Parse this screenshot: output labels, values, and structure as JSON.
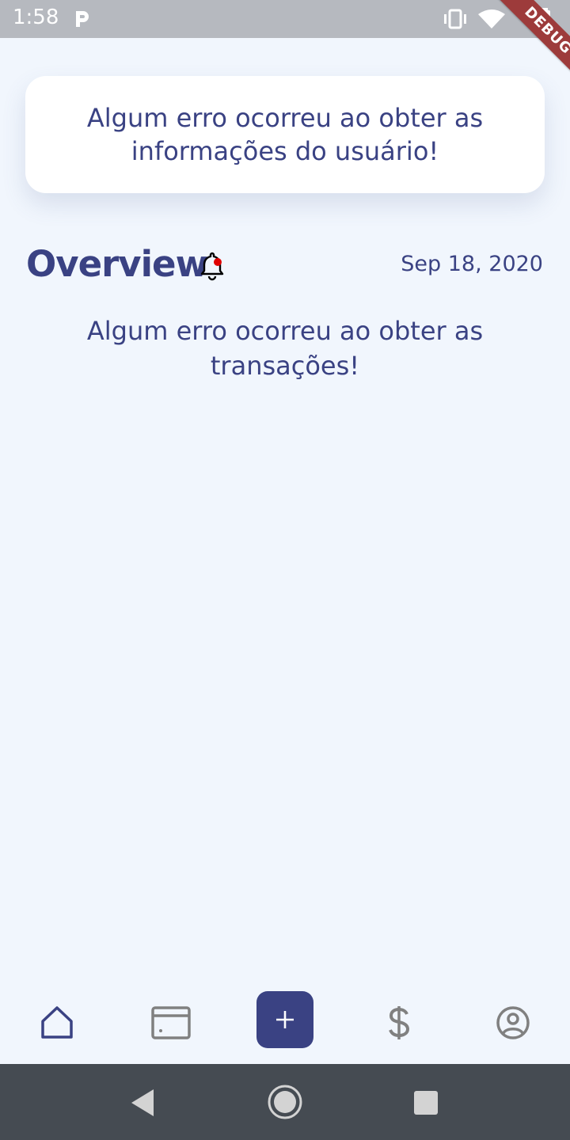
{
  "status_bar": {
    "time": "1:58",
    "icons": [
      "app-p-icon",
      "vibrate-icon",
      "wifi-icon",
      "battery-icon"
    ]
  },
  "debug_banner": {
    "label": "DEBUG"
  },
  "user_error": {
    "message": "Algum erro ocorreu ao obter as informações do usuário!"
  },
  "overview": {
    "title": "Overview",
    "date": "Sep 18, 2020",
    "notification_dot_color": "#e00000"
  },
  "transactions_error": {
    "message": "Algum erro ocorreu ao obter as transações!"
  },
  "bottom_nav": {
    "items": [
      {
        "icon": "home-icon",
        "active": true
      },
      {
        "icon": "card-icon",
        "active": false
      },
      {
        "icon": "plus-icon",
        "active": false
      },
      {
        "icon": "dollar-icon",
        "active": false
      },
      {
        "icon": "profile-icon",
        "active": false
      }
    ]
  },
  "colors": {
    "background": "#f1f6fd",
    "primary": "#3a4283",
    "inactive_icon": "#808080",
    "status_bar": "#b6b9bf",
    "system_nav": "#454b52",
    "debug_banner": "#9d3b3b"
  },
  "system_nav": {
    "icons": [
      "back-icon",
      "home-circle-icon",
      "recents-icon"
    ]
  }
}
